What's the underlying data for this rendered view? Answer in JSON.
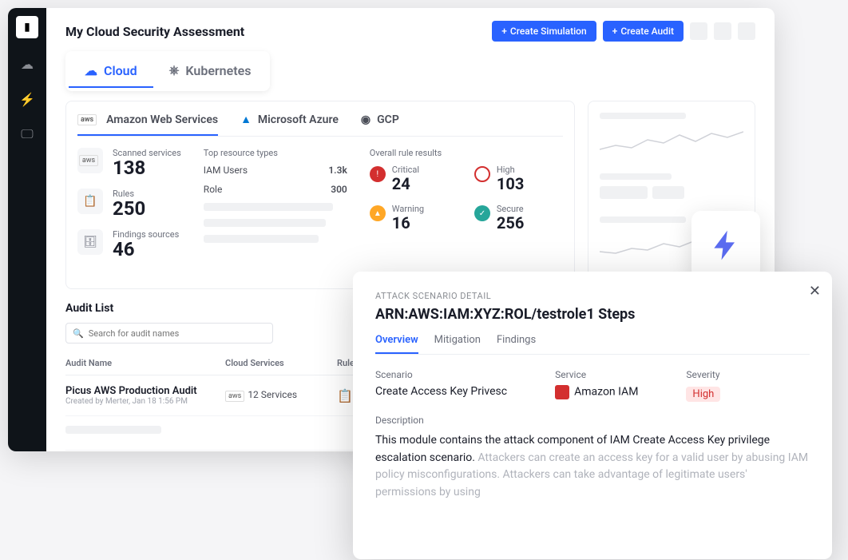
{
  "header": {
    "title": "My Cloud Security Assessment",
    "create_sim": "Create Simulation",
    "create_audit": "Create Audit"
  },
  "main_tabs": {
    "cloud": "Cloud",
    "k8s": "Kubernetes"
  },
  "providers": {
    "aws": "Amazon Web Services",
    "azure": "Microsoft Azure",
    "gcp": "GCP"
  },
  "stats": {
    "scanned_label": "Scanned services",
    "scanned_value": "138",
    "rules_label": "Rules",
    "rules_value": "250",
    "findings_label": "Findings sources",
    "findings_value": "46"
  },
  "resources": {
    "heading": "Top resource types",
    "r1_label": "IAM Users",
    "r1_value": "1.3k",
    "r2_label": "Role",
    "r2_value": "300"
  },
  "rules": {
    "heading": "Overall rule results",
    "critical_label": "Critical",
    "critical_value": "24",
    "high_label": "High",
    "high_value": "103",
    "warning_label": "Warning",
    "warning_value": "16",
    "secure_label": "Secure",
    "secure_value": "256"
  },
  "audit": {
    "heading": "Audit List",
    "search_placeholder": "Search for audit names",
    "col_name": "Audit Name",
    "col_services": "Cloud Services",
    "col_rules": "Rules",
    "row1_name": "Picus AWS Production Audit",
    "row1_meta": "Created by Merter, Jan 18 1:56 PM",
    "row1_services": "12 Services",
    "aws_badge": "aws"
  },
  "detail": {
    "eyebrow": "ATTACK SCENARIO DETAIL",
    "title": "ARN:AWS:IAM:XYZ:ROL/testrole1 Steps",
    "tab_overview": "Overview",
    "tab_mitigation": "Mitigation",
    "tab_findings": "Findings",
    "scenario_label": "Scenario",
    "scenario_value": "Create Access Key Privesc",
    "service_label": "Service",
    "service_value": "Amazon IAM",
    "severity_label": "Severity",
    "severity_value": "High",
    "desc_label": "Description",
    "desc_main": "This module contains the attack component of IAM Create Access Key privilege escalation scenario. ",
    "desc_faded": "Attackers can create an access key for a valid user by abusing IAM policy misconfigurations. Attackers can take advantage of legitimate users' permissions by using"
  }
}
